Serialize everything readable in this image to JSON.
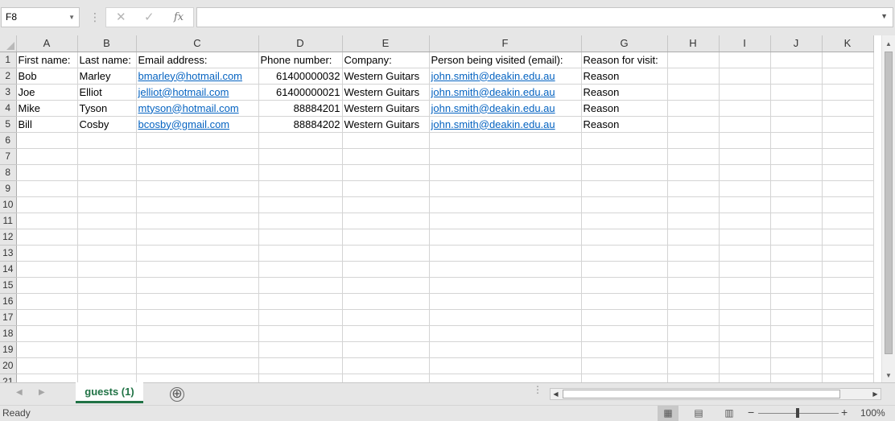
{
  "formula_bar": {
    "name_box": "F8",
    "cancel_icon": "✕",
    "enter_icon": "✓",
    "function_icon": "fx",
    "formula": ""
  },
  "columns": [
    "A",
    "B",
    "C",
    "D",
    "E",
    "F",
    "G",
    "H",
    "I",
    "J",
    "K"
  ],
  "rows": [
    {
      "num": "1",
      "cells": [
        "First name:",
        "Last name:",
        "Email address:",
        "Phone number:",
        "Company:",
        "Person being visited (email):",
        "Reason for visit:",
        "",
        "",
        "",
        ""
      ]
    },
    {
      "num": "2",
      "cells": [
        "Bob",
        "Marley",
        "bmarley@hotmail.com",
        "61400000032",
        "Western Guitars",
        "john.smith@deakin.edu.au",
        "Reason",
        "",
        "",
        "",
        ""
      ]
    },
    {
      "num": "3",
      "cells": [
        "Joe",
        "Elliot",
        "jelliot@hotmail.com",
        "61400000021",
        "Western Guitars",
        "john.smith@deakin.edu.au",
        "Reason",
        "",
        "",
        "",
        ""
      ]
    },
    {
      "num": "4",
      "cells": [
        "Mike",
        "Tyson",
        "mtyson@hotmail.com",
        "88884201",
        "Western Guitars",
        "john.smith@deakin.edu.au",
        "Reason",
        "",
        "",
        "",
        ""
      ]
    },
    {
      "num": "5",
      "cells": [
        "Bill",
        "Cosby",
        "bcosby@gmail.com",
        "88884202",
        "Western Guitars",
        "john.smith@deakin.edu.au",
        "Reason",
        "",
        "",
        "",
        ""
      ]
    },
    {
      "num": "6",
      "cells": [
        "",
        "",
        "",
        "",
        "",
        "",
        "",
        "",
        "",
        "",
        ""
      ]
    },
    {
      "num": "7",
      "cells": [
        "",
        "",
        "",
        "",
        "",
        "",
        "",
        "",
        "",
        "",
        ""
      ]
    },
    {
      "num": "8",
      "cells": [
        "",
        "",
        "",
        "",
        "",
        "",
        "",
        "",
        "",
        "",
        ""
      ]
    },
    {
      "num": "9",
      "cells": [
        "",
        "",
        "",
        "",
        "",
        "",
        "",
        "",
        "",
        "",
        ""
      ]
    },
    {
      "num": "10",
      "cells": [
        "",
        "",
        "",
        "",
        "",
        "",
        "",
        "",
        "",
        "",
        ""
      ]
    },
    {
      "num": "11",
      "cells": [
        "",
        "",
        "",
        "",
        "",
        "",
        "",
        "",
        "",
        "",
        ""
      ]
    },
    {
      "num": "12",
      "cells": [
        "",
        "",
        "",
        "",
        "",
        "",
        "",
        "",
        "",
        "",
        ""
      ]
    },
    {
      "num": "13",
      "cells": [
        "",
        "",
        "",
        "",
        "",
        "",
        "",
        "",
        "",
        "",
        ""
      ]
    },
    {
      "num": "14",
      "cells": [
        "",
        "",
        "",
        "",
        "",
        "",
        "",
        "",
        "",
        "",
        ""
      ]
    },
    {
      "num": "15",
      "cells": [
        "",
        "",
        "",
        "",
        "",
        "",
        "",
        "",
        "",
        "",
        ""
      ]
    },
    {
      "num": "16",
      "cells": [
        "",
        "",
        "",
        "",
        "",
        "",
        "",
        "",
        "",
        "",
        ""
      ]
    },
    {
      "num": "17",
      "cells": [
        "",
        "",
        "",
        "",
        "",
        "",
        "",
        "",
        "",
        "",
        ""
      ]
    },
    {
      "num": "18",
      "cells": [
        "",
        "",
        "",
        "",
        "",
        "",
        "",
        "",
        "",
        "",
        ""
      ]
    },
    {
      "num": "19",
      "cells": [
        "",
        "",
        "",
        "",
        "",
        "",
        "",
        "",
        "",
        "",
        ""
      ]
    },
    {
      "num": "20",
      "cells": [
        "",
        "",
        "",
        "",
        "",
        "",
        "",
        "",
        "",
        "",
        ""
      ]
    },
    {
      "num": "21",
      "cells": [
        "",
        "",
        "",
        "",
        "",
        "",
        "",
        "",
        "",
        "",
        ""
      ]
    }
  ],
  "sheet_tabs": {
    "active": "guests (1)",
    "add_icon": "⊕"
  },
  "status_bar": {
    "status": "Ready",
    "zoom_level": "100%"
  },
  "colors": {
    "link": "#0563c1",
    "accent": "#217346",
    "header_bg": "#e6e6e6",
    "gridline": "#d4d4d4"
  }
}
